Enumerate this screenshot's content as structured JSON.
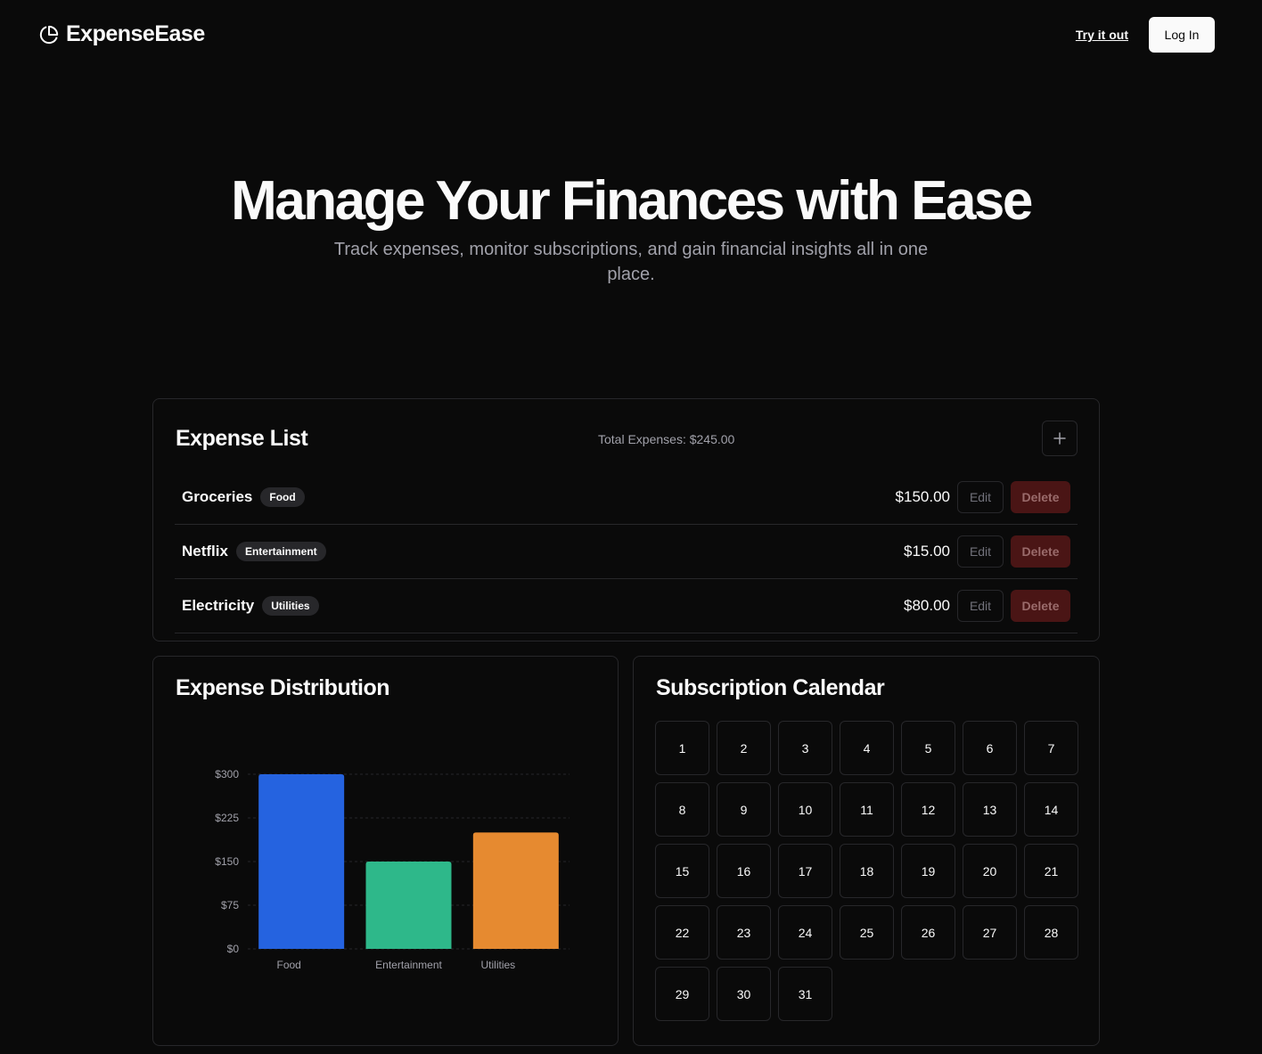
{
  "nav": {
    "brand": "ExpenseEase",
    "try_label": "Try it out",
    "login_label": "Log In"
  },
  "hero": {
    "title": "Manage Your Finances with Ease",
    "subtitle": "Track expenses, monitor subscriptions, and gain financial insights all in one place."
  },
  "expenses": {
    "title": "Expense List",
    "total": "Total Expenses: $245.00",
    "add_icon": "plus-icon",
    "items": [
      {
        "name": "Groceries",
        "category": "Food",
        "amount": "$150.00",
        "edit": "Edit",
        "delete": "Delete"
      },
      {
        "name": "Netflix",
        "category": "Entertainment",
        "amount": "$15.00",
        "edit": "Edit",
        "delete": "Delete"
      },
      {
        "name": "Electricity",
        "category": "Utilities",
        "amount": "$80.00",
        "edit": "Edit",
        "delete": "Delete"
      }
    ]
  },
  "distribution": {
    "title": "Expense Distribution"
  },
  "calendar": {
    "title": "Subscription Calendar",
    "days": [
      "1",
      "2",
      "3",
      "4",
      "5",
      "6",
      "7",
      "8",
      "9",
      "10",
      "11",
      "12",
      "13",
      "14",
      "15",
      "16",
      "17",
      "18",
      "19",
      "20",
      "21",
      "22",
      "23",
      "24",
      "25",
      "26",
      "27",
      "28",
      "29",
      "30",
      "31"
    ]
  },
  "colors": {
    "food": "#2563e0",
    "entertainment": "#2eb88a",
    "utilities": "#e68a30"
  },
  "chart_data": {
    "type": "bar",
    "categories": [
      "Food",
      "Entertainment",
      "Utilities"
    ],
    "values": [
      300,
      150,
      200
    ],
    "colors": [
      "#2563e0",
      "#2eb88a",
      "#e68a30"
    ],
    "yticks": [
      "$0",
      "$75",
      "$150",
      "$225",
      "$300"
    ],
    "ylim": [
      0,
      300
    ],
    "grid": "dashed horizontal"
  }
}
